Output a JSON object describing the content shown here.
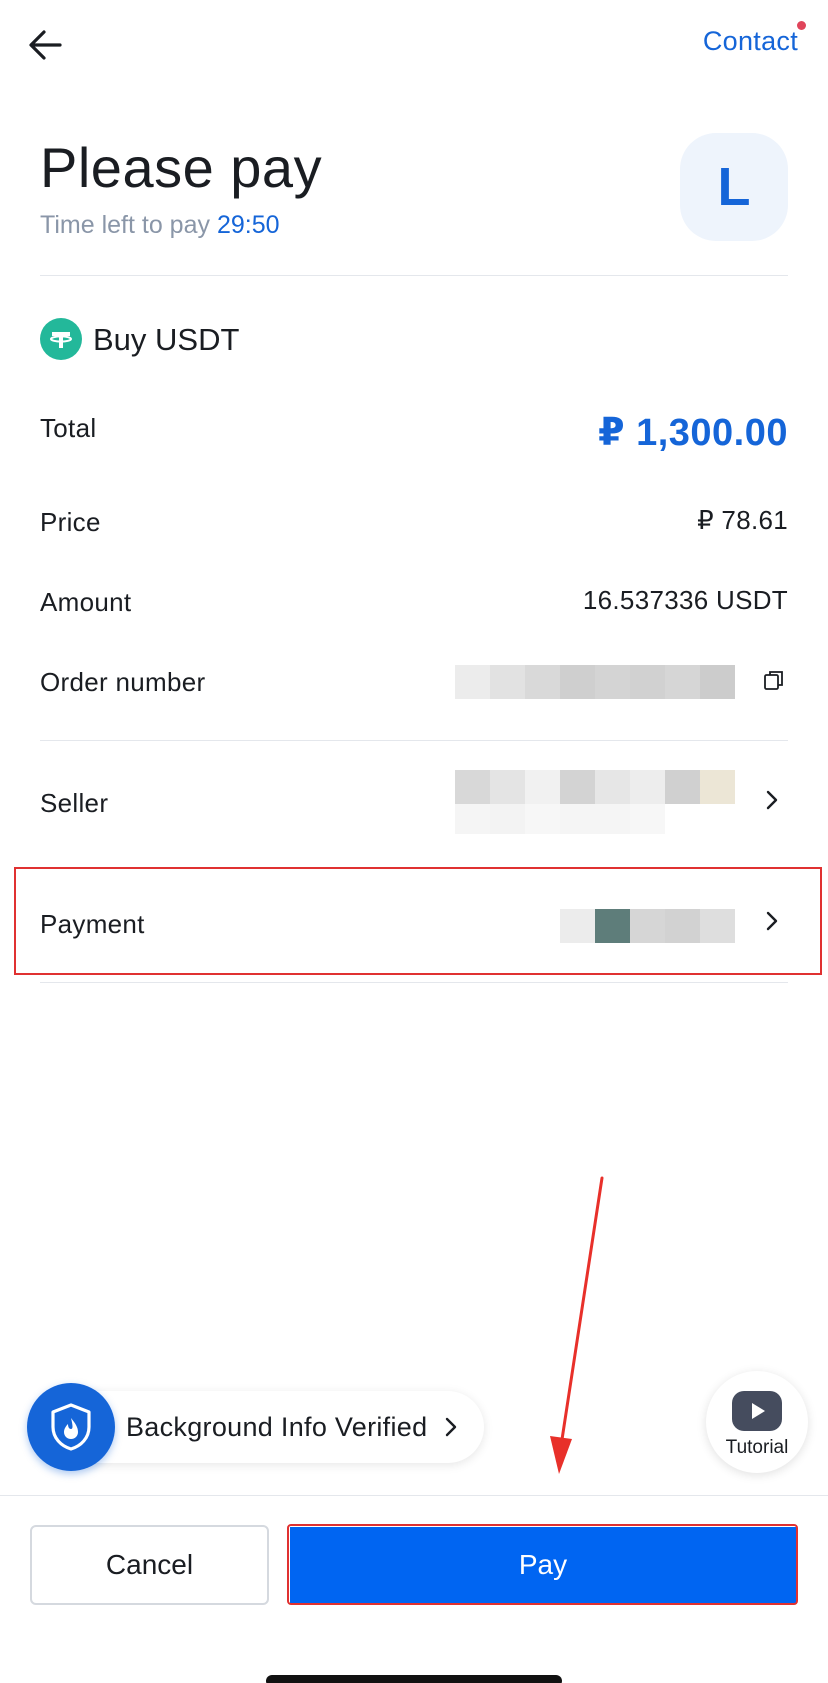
{
  "header": {
    "contact_label": "Contact",
    "title": "Please pay",
    "time_left_label": "Time left to pay",
    "timer": "29:50",
    "avatar_letter": "L"
  },
  "order": {
    "heading": "Buy USDT",
    "total_label": "Total",
    "total_value": "₽ 1,300.00",
    "price_label": "Price",
    "price_value": "₽ 78.61",
    "amount_label": "Amount",
    "amount_value": "16.537336 USDT",
    "order_number_label": "Order number",
    "seller_label": "Seller",
    "payment_label": "Payment"
  },
  "footer": {
    "verified_label": "Background Info Verified",
    "tutorial_label": "Tutorial",
    "cancel_label": "Cancel",
    "pay_label": "Pay"
  },
  "colors": {
    "accent": "#1565d8",
    "pay_button": "#0065f2",
    "highlight": "#e03131",
    "usdt": "#23b89a"
  },
  "icons": [
    "back-arrow-icon",
    "tether-icon",
    "copy-icon",
    "chevron-right-icon",
    "shield-icon",
    "play-icon"
  ]
}
